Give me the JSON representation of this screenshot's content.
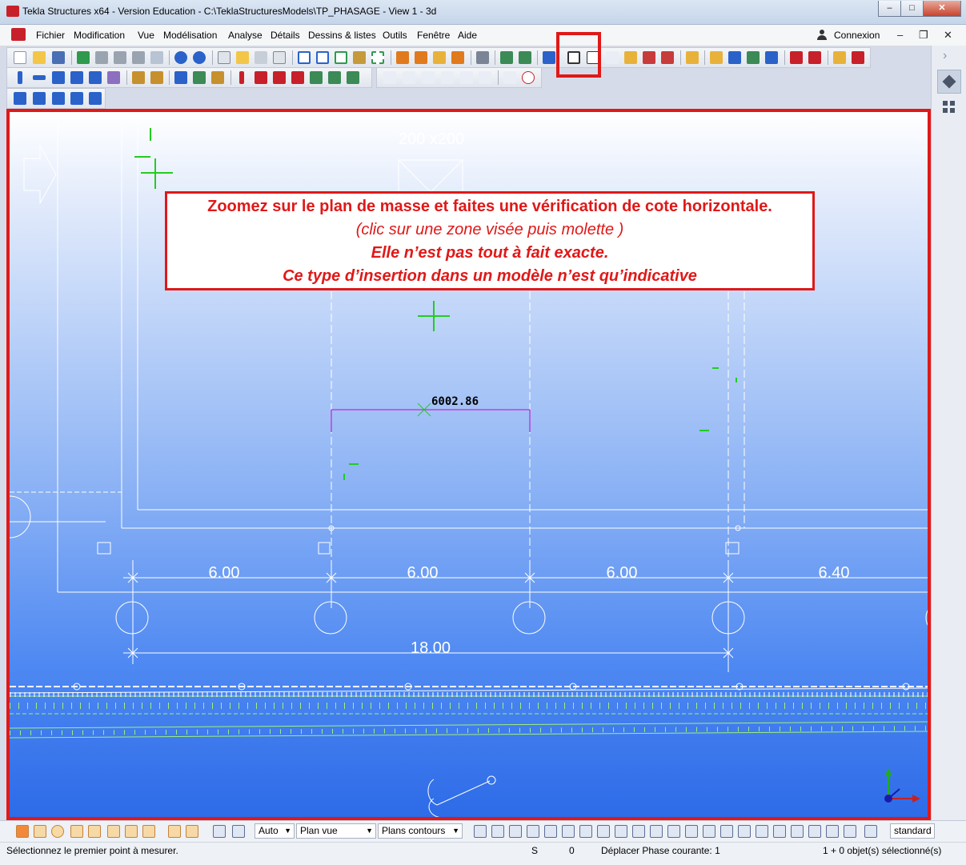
{
  "window": {
    "title": "Tekla Structures x64 - Version Education - C:\\TeklaStructuresModels\\TP_PHASAGE - View 1 - 3d",
    "minimize": "–",
    "maximize": "□",
    "close": "✕"
  },
  "menu": {
    "items": [
      "Fichier",
      "Modification",
      "Vue",
      "Modélisation",
      "Analyse",
      "Détails",
      "Dessins & listes",
      "Outils",
      "Fenêtre",
      "Aide"
    ],
    "connexion": "Connexion",
    "mdi_minimize": "–",
    "mdi_restore": "❐",
    "mdi_close": "✕"
  },
  "right_panel": {
    "chevron": "›"
  },
  "instruction": {
    "line1": "Zoomez sur le plan de masse et faites une vérification de cote horizontale.",
    "line2": "(clic sur une zone visée puis molette )",
    "line3": "Elle n’est pas tout à fait exacte.",
    "line4": "Ce type d’insertion dans un modèle n’est qu’indicative"
  },
  "drawing": {
    "measure_value": "6002.86",
    "section_label": "200 x200",
    "span_dims": [
      "6.00",
      "6.00",
      "6.00",
      "6.40"
    ],
    "total_dim": "18.00"
  },
  "bottom": {
    "auto": "Auto",
    "plan_vue": "Plan vue",
    "plans_contours": "Plans contours",
    "standard": "standard"
  },
  "status": {
    "prompt": "Sélectionnez le premier point à mesurer.",
    "s": "S",
    "zero": "0",
    "phase": "Déplacer Phase courante: 1",
    "selection": "1 + 0 objet(s) sélectionné(s)"
  },
  "colors": {
    "highlight": "#e01818",
    "dim_lines": "#ffffff",
    "green_marks": "#22cc22",
    "measure_line": "#d000d0"
  }
}
